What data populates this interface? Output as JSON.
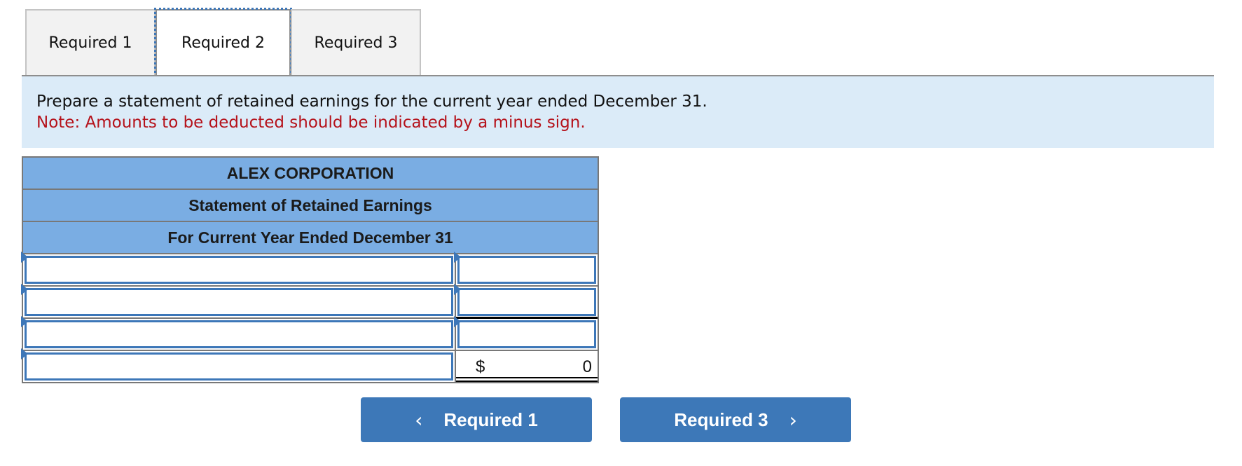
{
  "tabs": [
    {
      "label": "Required 1",
      "active": false
    },
    {
      "label": "Required 2",
      "active": true
    },
    {
      "label": "Required 3",
      "active": false
    }
  ],
  "instructions": {
    "text": "Prepare a statement of retained earnings for the current year ended December 31.",
    "note": "Note: Amounts to be deducted should be indicated by a minus sign."
  },
  "statement": {
    "company": "ALEX CORPORATION",
    "title": "Statement of Retained Earnings",
    "period": "For Current Year Ended December 31",
    "rows": [
      {
        "label": "",
        "amount": ""
      },
      {
        "label": "",
        "amount": ""
      },
      {
        "label": "",
        "amount": ""
      },
      {
        "label": "",
        "currency": "$",
        "amount": "0"
      }
    ]
  },
  "navigation": {
    "prev_label": "Required 1",
    "prev_icon": "chevron-left-icon",
    "prev_glyph": "‹",
    "next_label": "Required 3",
    "next_icon": "chevron-right-icon",
    "next_glyph": "›"
  },
  "colors": {
    "accent": "#3d78b8",
    "header_fill": "#7aade3",
    "info_bg": "#dbebf8",
    "note_red": "#b5121b"
  }
}
